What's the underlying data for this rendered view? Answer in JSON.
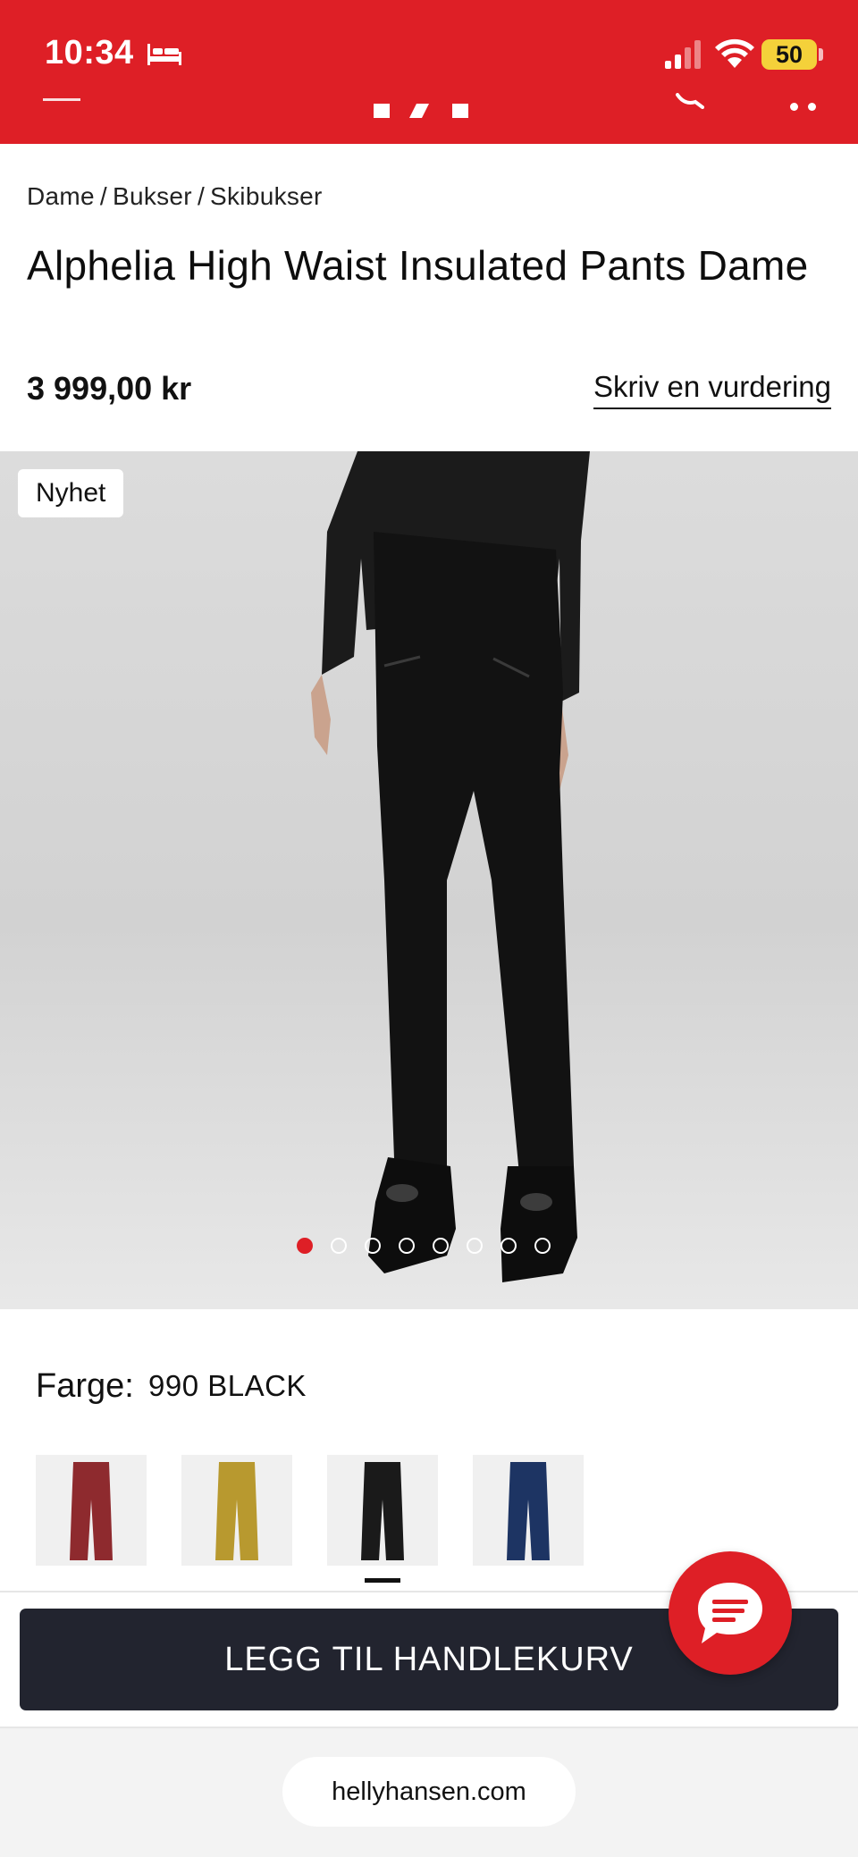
{
  "status_bar": {
    "time": "10:34",
    "battery_level": "50",
    "icons": [
      "bed-icon",
      "signal-icon",
      "wifi-icon"
    ]
  },
  "header": {
    "icons": [
      "hamburger-icon",
      "logo",
      "search-icon",
      "more-icon"
    ],
    "background_color": "#de1f26"
  },
  "breadcrumb": [
    "Dame",
    "Bukser",
    "Skibukser"
  ],
  "product": {
    "title": "Alphelia High Waist Insulated Pants Dame",
    "price": "3 999,00 kr",
    "review_link": "Skriv en vurdering",
    "badge": "Nyhet"
  },
  "gallery": {
    "image_count": 8,
    "active_index": 0
  },
  "color": {
    "label": "Farge:",
    "value": "990 BLACK",
    "swatches": [
      {
        "name": "red",
        "color": "#8e2a2e"
      },
      {
        "name": "mustard",
        "color": "#b8992f"
      },
      {
        "name": "black",
        "color": "#1a1a1a",
        "selected": true
      },
      {
        "name": "navy",
        "color": "#1d3463"
      }
    ]
  },
  "cart": {
    "button_label": "LEGG TIL HANDLEKURV",
    "button_color": "#22242f"
  },
  "browser": {
    "url": "hellyhansen.com"
  }
}
